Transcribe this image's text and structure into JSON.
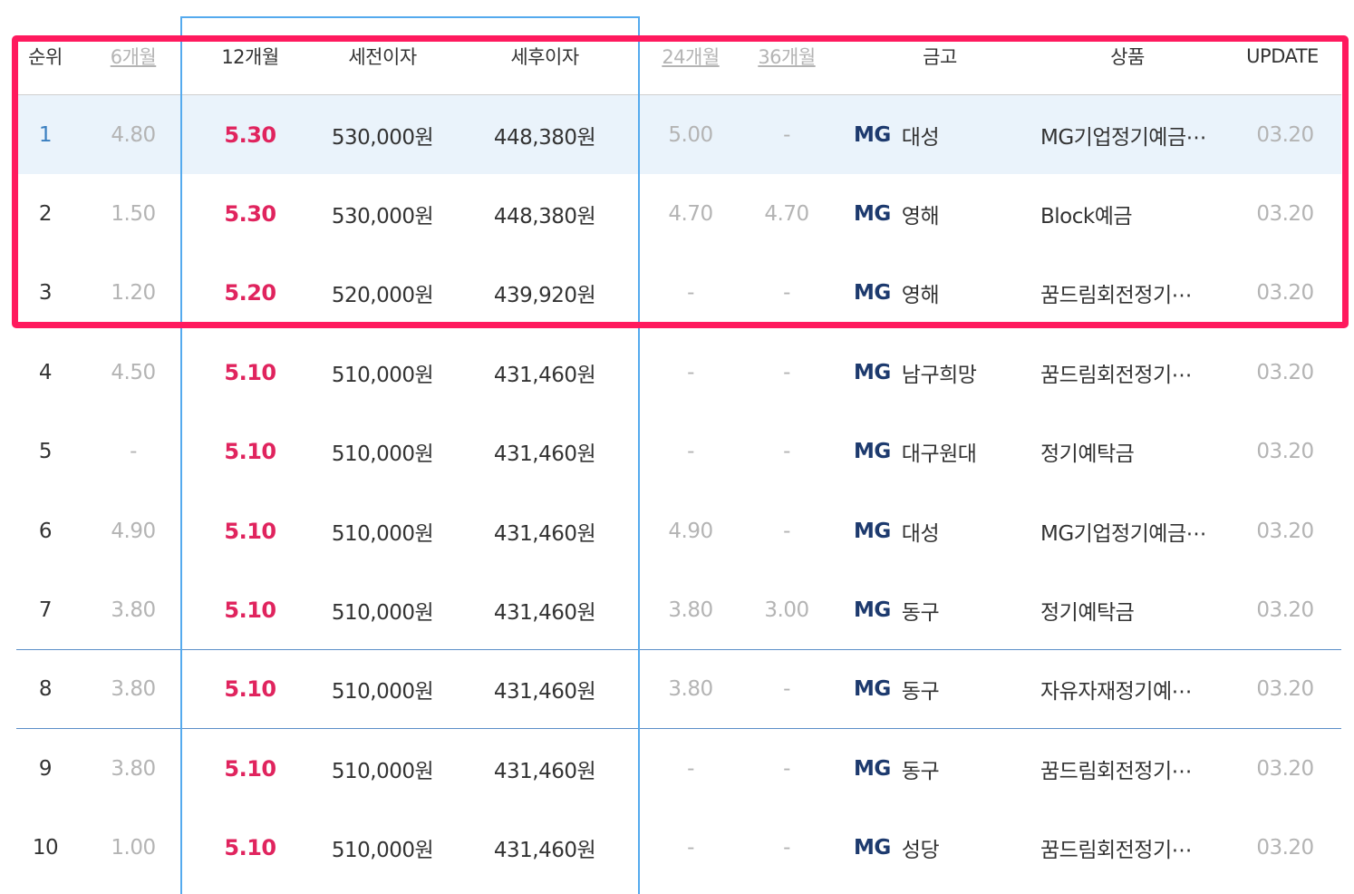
{
  "headers": {
    "rank": "순위",
    "m6": "6개월",
    "m12": "12개월",
    "pre_tax": "세전이자",
    "post_tax": "세후이자",
    "m24": "24개월",
    "m36": "36개월",
    "bank": "금고",
    "product": "상품",
    "update": "UPDATE"
  },
  "bank_prefix": "MG",
  "rows": [
    {
      "rank": "1",
      "m6": "4.80",
      "m12": "5.30",
      "pre_tax": "530,000원",
      "post_tax": "448,380원",
      "m24": "5.00",
      "m36": "-",
      "bank": "대성",
      "product": "MG기업정기예금⋯",
      "update": "03.20"
    },
    {
      "rank": "2",
      "m6": "1.50",
      "m12": "5.30",
      "pre_tax": "530,000원",
      "post_tax": "448,380원",
      "m24": "4.70",
      "m36": "4.70",
      "bank": "영해",
      "product": "Block예금",
      "update": "03.20"
    },
    {
      "rank": "3",
      "m6": "1.20",
      "m12": "5.20",
      "pre_tax": "520,000원",
      "post_tax": "439,920원",
      "m24": "-",
      "m36": "-",
      "bank": "영해",
      "product": "꿈드림회전정기⋯",
      "update": "03.20"
    },
    {
      "rank": "4",
      "m6": "4.50",
      "m12": "5.10",
      "pre_tax": "510,000원",
      "post_tax": "431,460원",
      "m24": "-",
      "m36": "-",
      "bank": "남구희망",
      "product": "꿈드림회전정기⋯",
      "update": "03.20"
    },
    {
      "rank": "5",
      "m6": "-",
      "m12": "5.10",
      "pre_tax": "510,000원",
      "post_tax": "431,460원",
      "m24": "-",
      "m36": "-",
      "bank": "대구원대",
      "product": "정기예탁금",
      "update": "03.20"
    },
    {
      "rank": "6",
      "m6": "4.90",
      "m12": "5.10",
      "pre_tax": "510,000원",
      "post_tax": "431,460원",
      "m24": "4.90",
      "m36": "-",
      "bank": "대성",
      "product": "MG기업정기예금⋯",
      "update": "03.20"
    },
    {
      "rank": "7",
      "m6": "3.80",
      "m12": "5.10",
      "pre_tax": "510,000원",
      "post_tax": "431,460원",
      "m24": "3.80",
      "m36": "3.00",
      "bank": "동구",
      "product": "정기예탁금",
      "update": "03.20"
    },
    {
      "rank": "8",
      "m6": "3.80",
      "m12": "5.10",
      "pre_tax": "510,000원",
      "post_tax": "431,460원",
      "m24": "3.80",
      "m36": "-",
      "bank": "동구",
      "product": "자유자재정기예⋯",
      "update": "03.20"
    },
    {
      "rank": "9",
      "m6": "3.80",
      "m12": "5.10",
      "pre_tax": "510,000원",
      "post_tax": "431,460원",
      "m24": "-",
      "m36": "-",
      "bank": "동구",
      "product": "꿈드림회전정기⋯",
      "update": "03.20"
    },
    {
      "rank": "10",
      "m6": "1.00",
      "m12": "5.10",
      "pre_tax": "510,000원",
      "post_tax": "431,460원",
      "m24": "-",
      "m36": "-",
      "bank": "성당",
      "product": "꿈드림회전정기⋯",
      "update": "03.20"
    }
  ],
  "colors": {
    "rate_highlight": "#e0245e",
    "column_box": "#55aaee",
    "annotation_box": "#ff1a5e",
    "first_row_bg": "#eaf3fb",
    "bank_logo": "#1d3a6e"
  }
}
